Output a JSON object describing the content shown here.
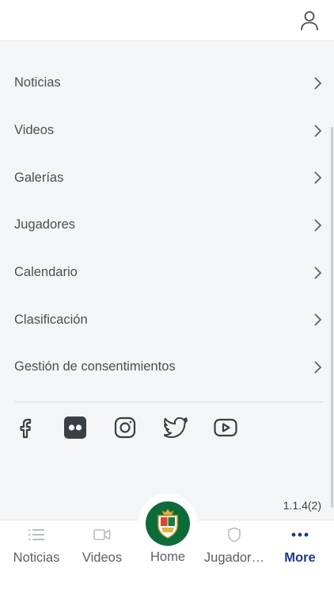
{
  "header": {
    "profile_icon": "user-icon"
  },
  "menu": {
    "items": [
      {
        "label": "Noticias"
      },
      {
        "label": "Videos"
      },
      {
        "label": "Galerías"
      },
      {
        "label": "Jugadores"
      },
      {
        "label": "Calendario"
      },
      {
        "label": "Clasificación"
      },
      {
        "label": "Gestión de consentimientos"
      }
    ]
  },
  "social": {
    "icons": [
      "facebook-icon",
      "flickr-icon",
      "instagram-icon",
      "twitter-icon",
      "youtube-icon"
    ]
  },
  "version": "1.1.4(2)",
  "tabbar": {
    "tabs": [
      {
        "label": "Noticias",
        "icon": "list-icon"
      },
      {
        "label": "Videos",
        "icon": "video-icon"
      },
      {
        "label": "Home",
        "icon": "club-crest-icon"
      },
      {
        "label": "Jugador…",
        "icon": "shield-icon"
      },
      {
        "label": "More",
        "icon": "more-dots-icon",
        "active": true
      }
    ]
  },
  "colors": {
    "accent": "#1e3a8a",
    "crest_green": "#0d6b3a",
    "background": "#f4f5f6"
  }
}
